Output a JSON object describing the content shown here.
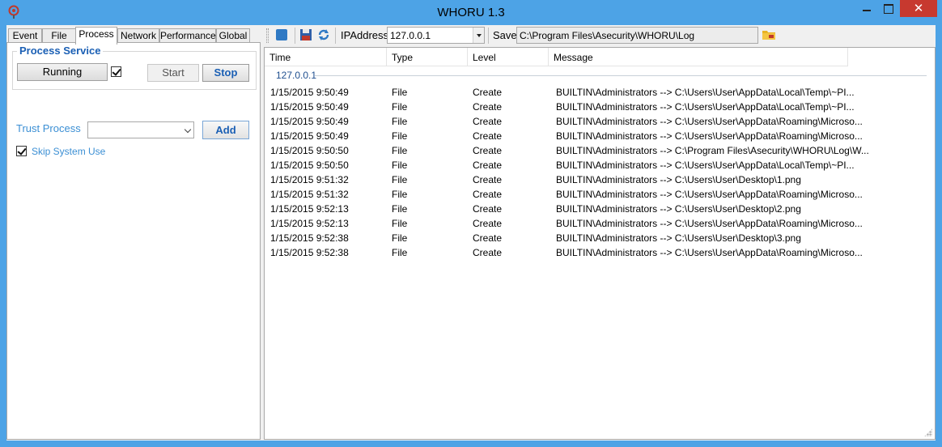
{
  "window": {
    "title": "WHORU 1.3",
    "close_glyph": "✕"
  },
  "tabs": [
    {
      "label": "Event"
    },
    {
      "label": "File"
    },
    {
      "label": "Process"
    },
    {
      "label": "Network"
    },
    {
      "label": "Performance"
    },
    {
      "label": "Global"
    }
  ],
  "process_service": {
    "title": "Process Service",
    "status": "Running",
    "checked": true,
    "start_label": "Start",
    "stop_label": "Stop"
  },
  "trust": {
    "label": "Trust Process",
    "value": "",
    "add_label": "Add"
  },
  "skip": {
    "label": "Skip System Use",
    "checked": true
  },
  "toolbar": {
    "ip_label": "IPAddress",
    "ip_value": "127.0.0.1",
    "save_label": "Save",
    "save_path": "C:\\Program Files\\Asecurity\\WHORU\\Log"
  },
  "log": {
    "columns": [
      "Time",
      "Type",
      "Level",
      "Message"
    ],
    "group": "127.0.0.1",
    "rows": [
      {
        "time": "1/15/2015 9:50:49",
        "type": "File",
        "level": "Create",
        "message": "BUILTIN\\Administrators --> C:\\Users\\User\\AppData\\Local\\Temp\\~PI..."
      },
      {
        "time": "1/15/2015 9:50:49",
        "type": "File",
        "level": "Create",
        "message": "BUILTIN\\Administrators --> C:\\Users\\User\\AppData\\Local\\Temp\\~PI..."
      },
      {
        "time": "1/15/2015 9:50:49",
        "type": "File",
        "level": "Create",
        "message": "BUILTIN\\Administrators --> C:\\Users\\User\\AppData\\Roaming\\Microso..."
      },
      {
        "time": "1/15/2015 9:50:49",
        "type": "File",
        "level": "Create",
        "message": "BUILTIN\\Administrators --> C:\\Users\\User\\AppData\\Roaming\\Microso..."
      },
      {
        "time": "1/15/2015 9:50:50",
        "type": "File",
        "level": "Create",
        "message": "BUILTIN\\Administrators --> C:\\Program Files\\Asecurity\\WHORU\\Log\\W..."
      },
      {
        "time": "1/15/2015 9:50:50",
        "type": "File",
        "level": "Create",
        "message": "BUILTIN\\Administrators --> C:\\Users\\User\\AppData\\Local\\Temp\\~PI..."
      },
      {
        "time": "1/15/2015 9:51:32",
        "type": "File",
        "level": "Create",
        "message": "BUILTIN\\Administrators --> C:\\Users\\User\\Desktop\\1.png"
      },
      {
        "time": "1/15/2015 9:51:32",
        "type": "File",
        "level": "Create",
        "message": "BUILTIN\\Administrators --> C:\\Users\\User\\AppData\\Roaming\\Microso..."
      },
      {
        "time": "1/15/2015 9:52:13",
        "type": "File",
        "level": "Create",
        "message": "BUILTIN\\Administrators --> C:\\Users\\User\\Desktop\\2.png"
      },
      {
        "time": "1/15/2015 9:52:13",
        "type": "File",
        "level": "Create",
        "message": "BUILTIN\\Administrators --> C:\\Users\\User\\AppData\\Roaming\\Microso..."
      },
      {
        "time": "1/15/2015 9:52:38",
        "type": "File",
        "level": "Create",
        "message": "BUILTIN\\Administrators --> C:\\Users\\User\\Desktop\\3.png"
      },
      {
        "time": "1/15/2015 9:52:38",
        "type": "File",
        "level": "Create",
        "message": "BUILTIN\\Administrators --> C:\\Users\\User\\AppData\\Roaming\\Microso..."
      }
    ]
  },
  "colors": {
    "titlebar": "#4da3e6",
    "close": "#c7392f",
    "accent": "#1a5fb4",
    "label_blue": "#3b8fd4"
  }
}
